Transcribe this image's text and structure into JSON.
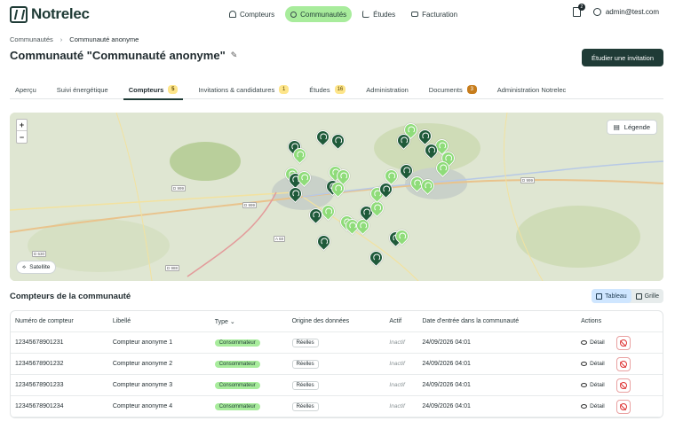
{
  "app": {
    "name": "Notrelec"
  },
  "nav": {
    "items": [
      {
        "label": "Compteurs",
        "icon": "gauge-icon"
      },
      {
        "label": "Communautés",
        "icon": "users-icon",
        "active": true
      },
      {
        "label": "Études",
        "icon": "chart-icon"
      },
      {
        "label": "Facturation",
        "icon": "credit-card-icon"
      }
    ],
    "documents_count": "2",
    "user_email": "admin@test.com"
  },
  "breadcrumb": {
    "root": "Communautés",
    "separator": "›",
    "current": "Communauté anonyme"
  },
  "page": {
    "title": "Communauté \"Communauté anonyme\"",
    "primary_action": "Étudier une invitation"
  },
  "tabs": [
    {
      "label": "Aperçu"
    },
    {
      "label": "Suivi énergétique"
    },
    {
      "label": "Compteurs",
      "badge": "5",
      "active": true
    },
    {
      "label": "Invitations & candidatures",
      "badge": "1"
    },
    {
      "label": "Études",
      "badge": "16"
    },
    {
      "label": "Administration"
    },
    {
      "label": "Documents",
      "badge": "3",
      "badge_style": "orange"
    },
    {
      "label": "Administration Notrelec"
    }
  ],
  "map": {
    "zoom_in": "+",
    "zoom_out": "−",
    "legend_label": "Légende",
    "satellite_label": "Satellite",
    "road_labels": [
      "D 999",
      "D 999",
      "D 999",
      "A 68",
      "D 630",
      "D 988"
    ]
  },
  "meters_section": {
    "title": "Compteurs de la communauté",
    "view_table": "Tableau",
    "view_grid": "Grille"
  },
  "table": {
    "headers": [
      "Numéro de compteur",
      "Libellé",
      "Type",
      "Origine des données",
      "Actif",
      "Date d'entrée dans la communauté",
      "Actions"
    ],
    "rows": [
      {
        "number": "12345678901231",
        "label": "Compteur anonyme 1",
        "type": "Consommateur",
        "origin": "Réelles",
        "active": "Inactif",
        "date": "24/09/2026 04:01",
        "action": "Détail"
      },
      {
        "number": "12345678901232",
        "label": "Compteur anonyme 2",
        "type": "Consommateur",
        "origin": "Réelles",
        "active": "Inactif",
        "date": "24/09/2026 04:01",
        "action": "Détail"
      },
      {
        "number": "12345678901233",
        "label": "Compteur anonyme 3",
        "type": "Consommateur",
        "origin": "Réelles",
        "active": "Inactif",
        "date": "24/09/2026 04:01",
        "action": "Détail"
      },
      {
        "number": "12345678901234",
        "label": "Compteur anonyme 4",
        "type": "Consommateur",
        "origin": "Réelles",
        "active": "Inactif",
        "date": "24/09/2026 04:01",
        "action": "Détail"
      }
    ]
  },
  "colors": {
    "brand_dark": "#1f3b36",
    "accent_green": "#a8ec9c",
    "pin_dark": "#1f5a3a",
    "pin_light": "#8fdc7a"
  }
}
